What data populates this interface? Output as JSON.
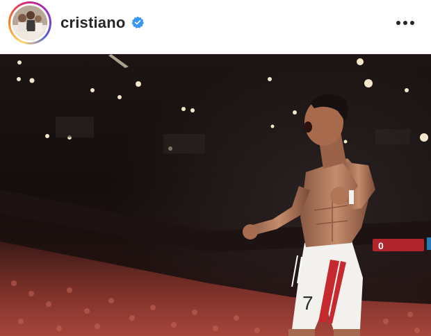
{
  "post": {
    "username": "cristiano",
    "verified": true,
    "avatar_icon": "profile-photo-family",
    "more_icon": "more-horizontal-icon",
    "image_icon": "celebration-photo"
  },
  "colors": {
    "verified_blue": "#3897f0",
    "story_ring_start": "#feda75",
    "story_ring_mid": "#d62976",
    "story_ring_end": "#4f5bd5",
    "username_text": "#262626"
  },
  "photo": {
    "jersey_number": "7",
    "scoreboard_text": "0"
  }
}
